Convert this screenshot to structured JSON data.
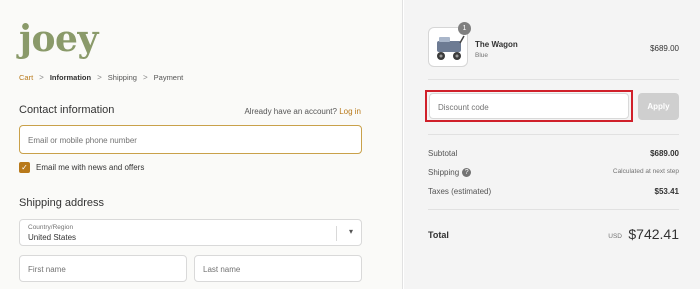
{
  "brand": {
    "logo_text": "joey"
  },
  "breadcrumb": {
    "items": [
      "Cart",
      "Information",
      "Shipping",
      "Payment"
    ],
    "separator": ">"
  },
  "contact": {
    "title": "Contact information",
    "account_prompt": "Already have an account?",
    "login_link": "Log in",
    "email_placeholder": "Email or mobile phone number",
    "newsletter_label": "Email me with news and offers",
    "newsletter_checked": true
  },
  "shipping": {
    "title": "Shipping address",
    "country_label": "Country/Region",
    "country_value": "United States",
    "first_name_placeholder": "First name",
    "last_name_placeholder": "Last name"
  },
  "summary": {
    "product": {
      "quantity": "1",
      "name": "The Wagon",
      "variant": "Blue",
      "price": "$689.00",
      "icon": "wagon-image"
    },
    "discount_placeholder": "Discount code",
    "apply_label": "Apply",
    "subtotal_label": "Subtotal",
    "subtotal_value": "$689.00",
    "shipping_label": "Shipping",
    "shipping_value": "Calculated at next step",
    "taxes_label": "Taxes (estimated)",
    "taxes_value": "$53.41",
    "total_label": "Total",
    "currency": "USD",
    "total_value": "$742.41"
  },
  "colors": {
    "accent": "#b8791a",
    "logo": "#8a9a6a",
    "highlight_outline": "#d0202a"
  }
}
